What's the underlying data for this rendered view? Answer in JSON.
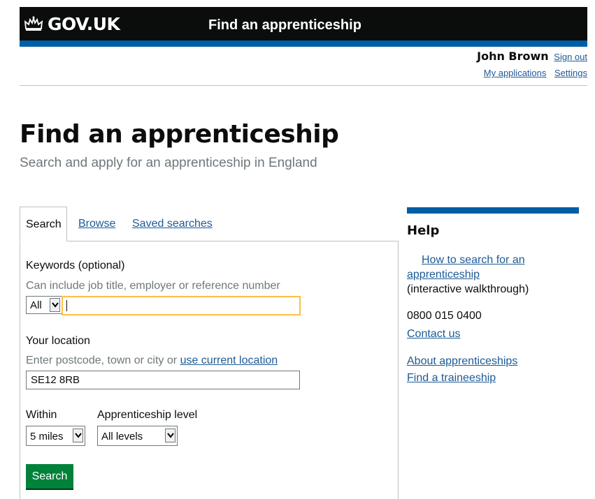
{
  "header": {
    "logo_text": "GOV.UK",
    "service_name": "Find an apprenticeship"
  },
  "account": {
    "user_name": "John Brown",
    "sign_out": "Sign out",
    "my_applications": "My applications",
    "settings": "Settings"
  },
  "page": {
    "title": "Find an apprenticeship",
    "subtitle": "Search and apply for an apprenticeship in England"
  },
  "tabs": {
    "search": "Search",
    "browse": "Browse",
    "saved": "Saved searches"
  },
  "form": {
    "keywords_label": "Keywords (optional)",
    "keywords_hint": "Can include job title, employer or reference number",
    "keywords_scope": "All",
    "keywords_value": "",
    "location_label": "Your location",
    "location_hint": "Enter postcode, town or city or",
    "location_link": "use current location",
    "location_value": "SE12 8RB",
    "within_label": "Within",
    "within_value": "5 miles",
    "level_label": "Apprenticeship level",
    "level_value": "All levels",
    "search_button": "Search"
  },
  "help": {
    "title": "Help",
    "walkthrough_link_1": "How to search for an",
    "walkthrough_link_2": "apprenticeship",
    "walkthrough_note": "(interactive walkthrough)",
    "phone": "0800 015 0400",
    "contact": "Contact us",
    "about": "About apprenticeships",
    "traineeship": "Find a traineeship"
  },
  "colors": {
    "header": "#0b0c0c",
    "brand_blue": "#005ea5",
    "link": "#1d5a96",
    "button_green": "#00823b",
    "focus": "#ffbf47"
  }
}
